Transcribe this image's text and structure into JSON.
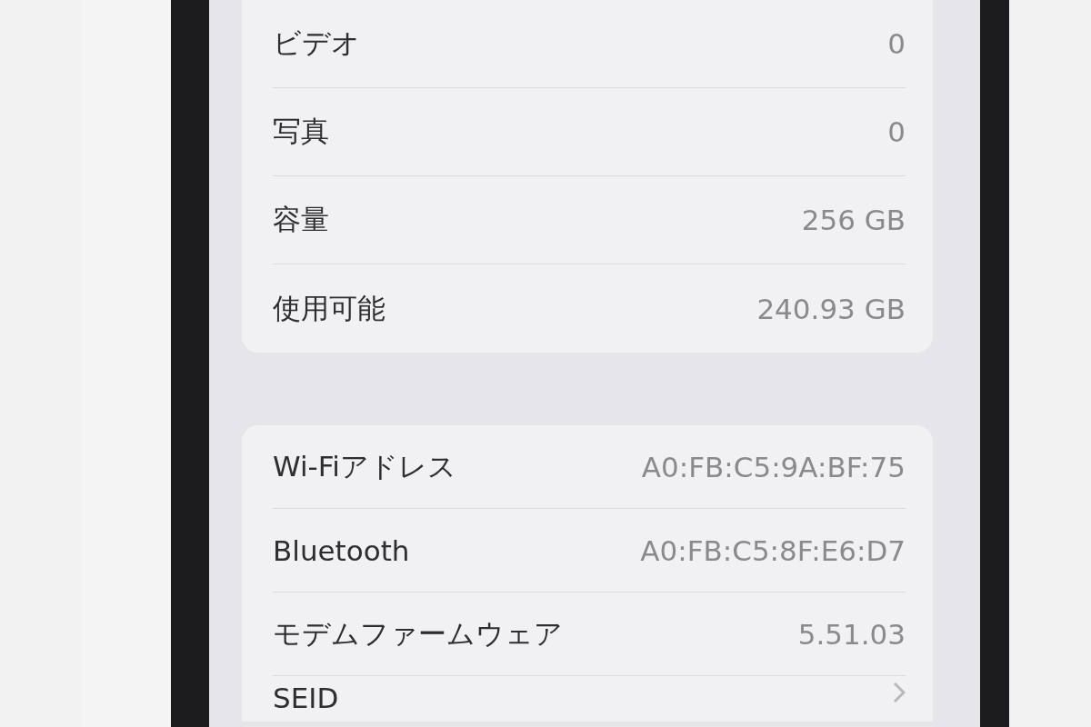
{
  "sections": [
    {
      "rows": [
        {
          "kind": "value",
          "label": "ビデオ",
          "value": "0"
        },
        {
          "kind": "value",
          "label": "写真",
          "value": "0"
        },
        {
          "kind": "value",
          "label": "容量",
          "value": "256 GB"
        },
        {
          "kind": "value",
          "label": "使用可能",
          "value": "240.93 GB"
        }
      ]
    },
    {
      "rows": [
        {
          "kind": "value",
          "label": "Wi-Fiアドレス",
          "value": "A0:FB:C5:9A:BF:75"
        },
        {
          "kind": "value",
          "label": "Bluetooth",
          "value": "A0:FB:C5:8F:E6:D7"
        },
        {
          "kind": "value",
          "label": "モデムファームウェア",
          "value": "5.51.03"
        },
        {
          "kind": "link",
          "label": "SEID"
        }
      ]
    }
  ]
}
